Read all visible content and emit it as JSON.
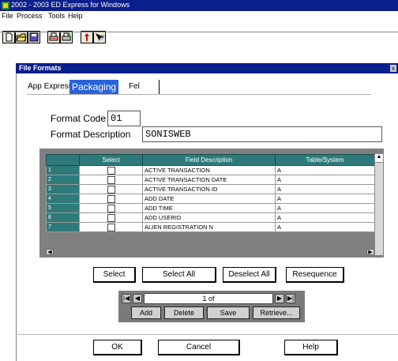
{
  "app": {
    "title": "2002 - 2003 ED Express for Windows"
  },
  "menu": [
    "File",
    "Process",
    "Tools",
    "Help"
  ],
  "toolbar": {
    "icons": [
      "new-icon",
      "open-icon",
      "save-icon",
      "print-icon",
      "print-setup-icon",
      "help-icon",
      "whats-this-icon"
    ]
  },
  "window": {
    "title": "File Formats",
    "close": "x"
  },
  "tabs": [
    "App Express",
    "Packaging",
    "Fel"
  ],
  "form": {
    "code_label": "Format Code",
    "code_value": "01",
    "desc_label": "Format Description",
    "desc_value": "SONISWEB"
  },
  "grid": {
    "columns": [
      "",
      "Select",
      "Field Description",
      "Table/System"
    ],
    "rows": [
      {
        "n": "1",
        "desc": "ACTIVE TRANSACTION",
        "sys": "A"
      },
      {
        "n": "2",
        "desc": "ACTIVE TRANSACTION DATE",
        "sys": "A"
      },
      {
        "n": "3",
        "desc": "ACTIVE TRANSACTION ID",
        "sys": "A"
      },
      {
        "n": "4",
        "desc": "ADD DATE",
        "sys": "A"
      },
      {
        "n": "5",
        "desc": "ADD TIME",
        "sys": "A"
      },
      {
        "n": "6",
        "desc": "ADD USERID",
        "sys": "A"
      },
      {
        "n": "7",
        "desc": "ALIEN REGISTRATION N",
        "sys": "A"
      }
    ]
  },
  "actions": [
    "Select",
    "Select All",
    "Deselect All",
    "Resequence"
  ],
  "nav": {
    "record": "1 of",
    "buttons": [
      "Add",
      "Delete",
      "Save",
      "Retrieve..."
    ]
  },
  "footer": [
    "OK",
    "Cancel",
    "Help"
  ],
  "colors": {
    "title": "#0a1e8c",
    "tab": "#2a62d8",
    "grid_header": "#2e7a7a"
  }
}
